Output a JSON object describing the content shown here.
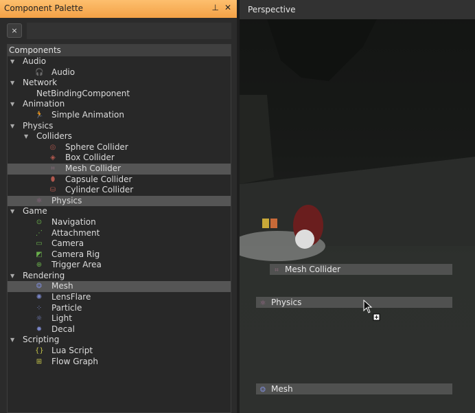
{
  "palette": {
    "title": "Component Palette",
    "pin_icon": "pin-icon",
    "close_icon": "close-icon",
    "clear_label": "×",
    "search_value": "",
    "tree_header": "Components",
    "rows": [
      {
        "label": "Audio",
        "level": 0,
        "type": "category"
      },
      {
        "label": "Audio",
        "level": 2,
        "icon": "headphones-icon",
        "glyph": "🎧",
        "color": "#e08a3c"
      },
      {
        "label": "Network",
        "level": 0,
        "type": "category"
      },
      {
        "label": "NetBindingComponent",
        "level": 1.5,
        "icon": "",
        "glyph": ""
      },
      {
        "label": "Animation",
        "level": 0,
        "type": "category"
      },
      {
        "label": "Simple Animation",
        "level": 2,
        "icon": "running-man-icon",
        "glyph": "🏃",
        "color": "#4aa3e0"
      },
      {
        "label": "Physics",
        "level": 0,
        "type": "category"
      },
      {
        "label": "Colliders",
        "level": 1,
        "type": "category"
      },
      {
        "label": "Sphere Collider",
        "level": 3,
        "icon": "sphere-icon",
        "glyph": "◎",
        "color": "#b0584e"
      },
      {
        "label": "Box Collider",
        "level": 3,
        "icon": "box-icon",
        "glyph": "◈",
        "color": "#b0584e"
      },
      {
        "label": "Mesh Collider",
        "level": 3,
        "icon": "mesh-grid-icon",
        "glyph": "⌗",
        "color": "#8a6a7a",
        "selected": true
      },
      {
        "label": "Capsule Collider",
        "level": 3,
        "icon": "capsule-icon",
        "glyph": "⬮",
        "color": "#b0584e"
      },
      {
        "label": "Cylinder Collider",
        "level": 3,
        "icon": "cylinder-icon",
        "glyph": "⛁",
        "color": "#b0584e"
      },
      {
        "label": "Physics",
        "level": 2,
        "icon": "atom-icon",
        "glyph": "⚛",
        "color": "#9a6a8a",
        "selected": true
      },
      {
        "label": "Game",
        "level": 0,
        "type": "category"
      },
      {
        "label": "Navigation",
        "level": 2,
        "icon": "navigation-icon",
        "glyph": "⊙",
        "color": "#6ab04c"
      },
      {
        "label": "Attachment",
        "level": 2,
        "icon": "attachment-icon",
        "glyph": "⋰",
        "color": "#6ab04c"
      },
      {
        "label": "Camera",
        "level": 2,
        "icon": "camera-icon",
        "glyph": "▭",
        "color": "#6ab04c"
      },
      {
        "label": "Camera Rig",
        "level": 2,
        "icon": "camera-rig-icon",
        "glyph": "◩",
        "color": "#6ab04c"
      },
      {
        "label": "Trigger Area",
        "level": 2,
        "icon": "trigger-icon",
        "glyph": "⊕",
        "color": "#6ab04c"
      },
      {
        "label": "Rendering",
        "level": 0,
        "type": "category"
      },
      {
        "label": "Mesh",
        "level": 2,
        "icon": "mesh-sphere-icon",
        "glyph": "❂",
        "color": "#7a86c8",
        "selected": true
      },
      {
        "label": "LensFlare",
        "level": 2,
        "icon": "lensflare-icon",
        "glyph": "✺",
        "color": "#7a86c8"
      },
      {
        "label": "Particle",
        "level": 2,
        "icon": "particle-icon",
        "glyph": "⁘",
        "color": "#7a86c8"
      },
      {
        "label": "Light",
        "level": 2,
        "icon": "light-icon",
        "glyph": "☼",
        "color": "#7a86c8"
      },
      {
        "label": "Decal",
        "level": 2,
        "icon": "decal-icon",
        "glyph": "✹",
        "color": "#7a86c8"
      },
      {
        "label": "Scripting",
        "level": 0,
        "type": "category"
      },
      {
        "label": "Lua Script",
        "level": 2,
        "icon": "lua-braces-icon",
        "glyph": "{}",
        "color": "#c8c84a"
      },
      {
        "label": "Flow Graph",
        "level": 2,
        "icon": "flow-graph-icon",
        "glyph": "⊞",
        "color": "#c8c84a"
      }
    ]
  },
  "viewport": {
    "title": "Perspective",
    "dropped": [
      {
        "label": "Mesh Collider",
        "icon": "mesh-grid-icon",
        "glyph": "⌗",
        "color": "#8a6a7a"
      },
      {
        "label": "Physics",
        "icon": "atom-icon",
        "glyph": "⚛",
        "color": "#9a6a8a"
      },
      {
        "label": "Mesh",
        "icon": "mesh-sphere-icon",
        "glyph": "❂",
        "color": "#7a86c8"
      }
    ]
  }
}
